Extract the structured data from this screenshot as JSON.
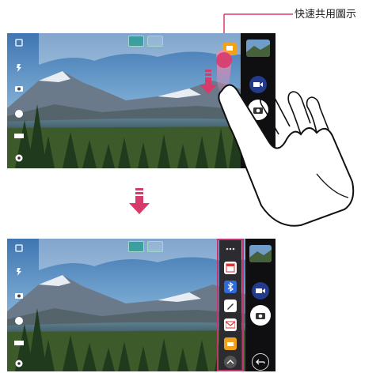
{
  "callout": {
    "label": "快速共用圖示"
  },
  "colors": {
    "accent_pink": "#d93a6c",
    "share_orange": "#f2a21a",
    "video_blue": "#243a8a",
    "magenta_frame": "#c8326e"
  },
  "top_screen": {
    "left_icons": [
      "flash-icon",
      "timer-icon",
      "camera-icon",
      "effect-icon",
      "mode-icon",
      "settings-icon"
    ],
    "top_icons": [
      "portrait-mode-icon",
      "wide-mode-icon"
    ],
    "right_buttons": [
      "gallery-thumbnail",
      "quick-share-icon",
      "video-record-button",
      "shutter-button"
    ]
  },
  "bottom_screen": {
    "left_icons": [
      "flash-icon",
      "timer-icon",
      "camera-icon",
      "effect-icon",
      "mode-icon",
      "settings-icon"
    ],
    "share_panel_items": [
      "more-icon",
      "calendar-icon",
      "bluetooth-icon",
      "pen-icon",
      "mail-icon",
      "folder-icon",
      "chevron-up-icon"
    ],
    "right_buttons": [
      "gallery-thumbnail",
      "video-record-button",
      "shutter-button",
      "back-button"
    ]
  }
}
